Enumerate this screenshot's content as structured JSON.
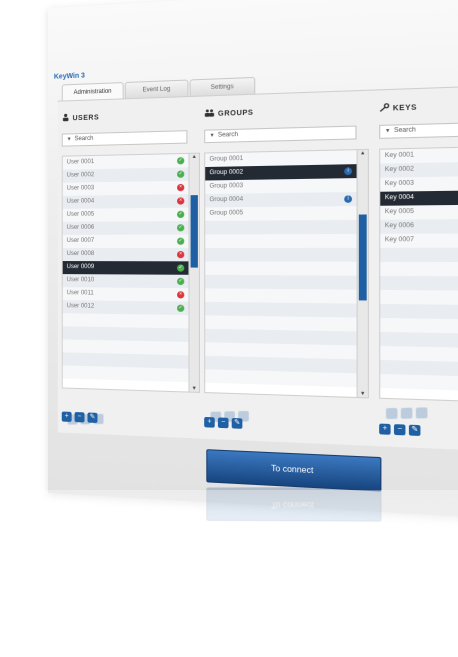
{
  "app": {
    "title": "KeyWin 3"
  },
  "tabs": [
    {
      "label": "Administration",
      "active": true
    },
    {
      "label": "Event Log",
      "active": false
    },
    {
      "label": "Settings",
      "active": false
    }
  ],
  "users": {
    "title": "USERS",
    "search_placeholder": "Search",
    "items": [
      {
        "label": "User 0001",
        "status": "ok"
      },
      {
        "label": "User 0002",
        "status": "ok"
      },
      {
        "label": "User 0003",
        "status": "no"
      },
      {
        "label": "User 0004",
        "status": "no"
      },
      {
        "label": "User 0005",
        "status": "ok"
      },
      {
        "label": "User 0006",
        "status": "ok"
      },
      {
        "label": "User 0007",
        "status": "ok"
      },
      {
        "label": "User 0008",
        "status": "no"
      },
      {
        "label": "User 0009",
        "status": "ok",
        "selected": true
      },
      {
        "label": "User 0010",
        "status": "ok"
      },
      {
        "label": "User 0011",
        "status": "no"
      },
      {
        "label": "User 0012",
        "status": "ok"
      }
    ]
  },
  "groups": {
    "title": "GROUPS",
    "search_placeholder": "Search",
    "items": [
      {
        "label": "Group 0001",
        "status": ""
      },
      {
        "label": "Group 0002",
        "status": "info",
        "selected": true
      },
      {
        "label": "Group 0003",
        "status": ""
      },
      {
        "label": "Group 0004",
        "status": "info"
      },
      {
        "label": "Group 0005",
        "status": ""
      }
    ]
  },
  "keys": {
    "title": "KEYS",
    "search_placeholder": "Search",
    "items": [
      {
        "label": "Key 0001",
        "status": ""
      },
      {
        "label": "Key 0002",
        "status": ""
      },
      {
        "label": "Key 0003",
        "status": ""
      },
      {
        "label": "Key 0004",
        "status": "",
        "selected": true
      },
      {
        "label": "Key 0005",
        "status": ""
      },
      {
        "label": "Key 0006",
        "status": ""
      },
      {
        "label": "Key 0007",
        "status": ""
      }
    ]
  },
  "actions": {
    "add": "+",
    "remove": "−",
    "edit": "✎"
  },
  "connect_label": "To connect",
  "icons": {
    "users": "person-icon",
    "groups": "people-icon",
    "keys": "key-icon"
  }
}
